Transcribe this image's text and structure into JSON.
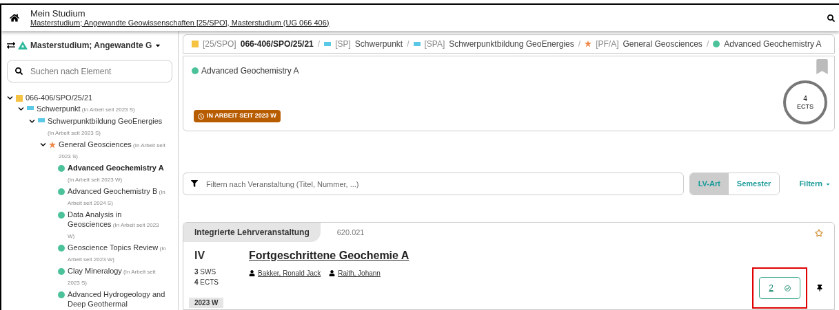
{
  "header": {
    "title": "Mein Studium",
    "subtitle": "Masterstudium; Angewandte Geowissenschaften [25/SPO], Masterstudium (UG 066 406)"
  },
  "sidebar": {
    "program": "Masterstudium; Angewandte G",
    "search": {
      "placeholder": "Suchen nach Element"
    },
    "tree": [
      {
        "label": "066-406/SPO/25/21",
        "kind": "square",
        "color": "#f5c242",
        "expanded": true,
        "children": [
          {
            "label": "Schwerpunkt",
            "status": "(In Arbeit seit 2023 S)",
            "kind": "bar",
            "color": "#5bc8e6",
            "expanded": true,
            "children": [
              {
                "label": "Schwerpunktbildung GeoEnergies",
                "status": "(In Arbeit seit 2023 S)",
                "kind": "bar",
                "color": "#5bc8e6",
                "expanded": true,
                "children": [
                  {
                    "label": "General Geosciences",
                    "status": "(In Arbeit seit 2023 S)",
                    "kind": "star",
                    "color": "#f08a4b",
                    "expanded": true,
                    "children": [
                      {
                        "label": "Advanced Geochemistry A",
                        "status": "(In Arbeit seit 2023 W)",
                        "kind": "dot",
                        "color": "#4cc29a",
                        "selected": true
                      },
                      {
                        "label": "Advanced Geochemistry B",
                        "status": "(In Arbeit seit 2024 S)",
                        "kind": "dot",
                        "color": "#4cc29a",
                        "selected": false
                      },
                      {
                        "label": "Data Analysis in Geosciences",
                        "status": "(In Arbeit seit 2023 W)",
                        "kind": "dot",
                        "color": "#4cc29a",
                        "selected": false
                      },
                      {
                        "label": "Geoscience Topics Review",
                        "status": "(In Arbeit seit 2023 W)",
                        "kind": "dot",
                        "color": "#4cc29a",
                        "selected": false
                      },
                      {
                        "label": "Clay Mineralogy",
                        "status": "(In Arbeit seit 2023 S)",
                        "kind": "dot",
                        "color": "#4cc29a",
                        "selected": false
                      },
                      {
                        "label": "Advanced Hydrogeology and Deep Geothermal",
                        "kind": "dot",
                        "color": "#4cc29a",
                        "selected": false
                      }
                    ]
                  }
                ]
              }
            ]
          }
        ]
      }
    ]
  },
  "breadcrumb": [
    {
      "code": "[25/SPO]",
      "label": "066-406/SPO/25/21",
      "kind": "square",
      "color": "#f5c242"
    },
    {
      "separator": "/",
      "code": "[SP]",
      "label": "Schwerpunkt",
      "kind": "bar",
      "color": "#5bc8e6"
    },
    {
      "separator": "/",
      "code": "[SPA]",
      "label": "Schwerpunktbildung GeoEnergies",
      "kind": "bar",
      "color": "#5bc8e6"
    },
    {
      "separator": "/",
      "code": "[PF/A]",
      "label": "General Geosciences",
      "kind": "star",
      "color": "#f08a4b"
    },
    {
      "separator": "/",
      "label": "Advanced Geochemistry A",
      "kind": "dot",
      "color": "#4cc29a"
    }
  ],
  "detail": {
    "title": "Advanced Geochemistry A",
    "color": "#4cc29a",
    "status": "IN ARBEIT SEIT 2023 W",
    "ects_value": "4",
    "ects_unit": "ECTS"
  },
  "filter": {
    "placeholder": "Filtern nach Veranstaltung (Titel, Nummer, ...)",
    "toggles": [
      {
        "label": "LV-Art",
        "selected": true
      },
      {
        "label": "Semester",
        "selected": false
      }
    ],
    "dropdown": "Filtern"
  },
  "course": {
    "type": "Integrierte Lehrveranstaltung",
    "number": "620.021",
    "abbr": "IV",
    "title": "Fortgeschrittene Geochemie A",
    "lecturers": [
      "Bakker, Ronald Jack",
      "Raith, Johann"
    ],
    "sws_value": "3",
    "sws_unit": "SWS",
    "ects_value": "4",
    "ects_unit": "ECTS",
    "semester": "2023 W",
    "count": "2",
    "highlighted": true
  }
}
